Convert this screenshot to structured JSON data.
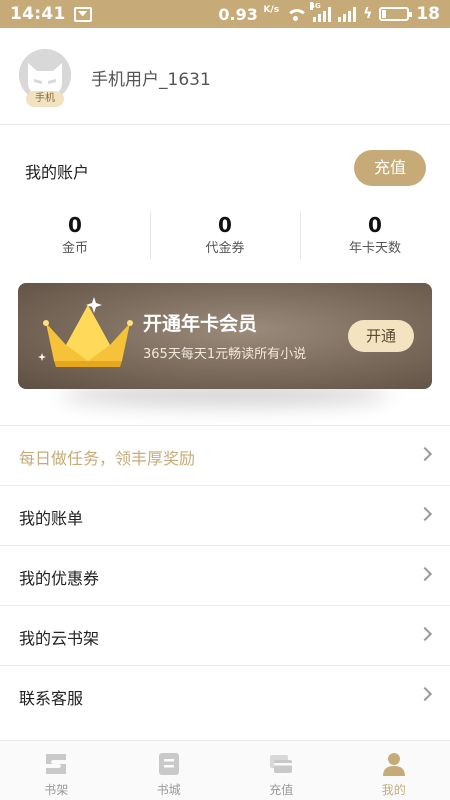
{
  "status_bar": {
    "time": "14:41",
    "speed_value": "0.93",
    "speed_unit": "K/s",
    "network_type": "4G",
    "battery_level": "18",
    "battery_fraction": 0.18
  },
  "profile": {
    "avatar_badge": "手机",
    "username": "手机用户_1631"
  },
  "account": {
    "title": "我的账户",
    "recharge_label": "充值",
    "stats": [
      {
        "value": "0",
        "label": "金币"
      },
      {
        "value": "0",
        "label": "代金券"
      },
      {
        "value": "0",
        "label": "年卡天数"
      }
    ]
  },
  "vip_banner": {
    "title": "开通年卡会员",
    "subtitle": "365天每天1元畅读所有小说",
    "button_label": "开通"
  },
  "menu": [
    {
      "label": "每日做任务，领丰厚奖励",
      "highlight": true
    },
    {
      "label": "我的账单",
      "highlight": false
    },
    {
      "label": "我的优惠券",
      "highlight": false
    },
    {
      "label": "我的云书架",
      "highlight": false
    },
    {
      "label": "联系客服",
      "highlight": false
    }
  ],
  "tab_bar": {
    "tabs": [
      {
        "label": "书架",
        "icon": "bookshelf-icon",
        "active": false
      },
      {
        "label": "书城",
        "icon": "bookstore-icon",
        "active": false
      },
      {
        "label": "充值",
        "icon": "recharge-icon",
        "active": false
      },
      {
        "label": "我的",
        "icon": "profile-icon",
        "active": true
      }
    ]
  },
  "colors": {
    "accent": "#c6ab78",
    "inactive_icon": "#c9c9c9",
    "banner_dark": "#5d4f43"
  }
}
